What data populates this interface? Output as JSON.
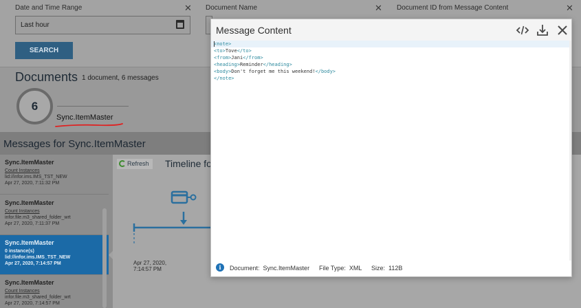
{
  "filters": {
    "date_range": {
      "label": "Date and Time Range",
      "value": "Last hour"
    },
    "document_name": {
      "label": "Document Name",
      "value": ""
    },
    "document_id": {
      "label": "Document ID from Message Content",
      "value": ""
    },
    "close_glyph": "✕",
    "search_label": "SEARCH"
  },
  "documents": {
    "title": "Documents",
    "summary": "1 document, 6 messages",
    "ring_count": "6",
    "doc_name": "Sync.ItemMaster"
  },
  "messages": {
    "title": "Messages for Sync.ItemMaster",
    "items": [
      {
        "name": "Sync.ItemMaster",
        "line1": "Count Instances",
        "line2": "lid://infor.ims.IMS_TST_NEW",
        "time": "Apr 27, 2020, 7:11:32 PM",
        "selected": false
      },
      {
        "name": "Sync.ItemMaster",
        "line1": "Count Instances",
        "line2": "infor.file.m3_shared_folder_wrt",
        "time": "Apr 27, 2020, 7:11:37 PM",
        "selected": false
      },
      {
        "name": "Sync.ItemMaster",
        "line1": "0 instance(s)",
        "line2": "lid://infor.ims.IMS_TST_NEW",
        "time": "Apr 27, 2020, 7:14:57 PM",
        "selected": true
      },
      {
        "name": "Sync.ItemMaster",
        "line1": "Count Instances",
        "line2": "infor.file.m3_shared_folder_wrt",
        "time": "Apr 27, 2020, 7:14:57 PM",
        "selected": false
      }
    ]
  },
  "timeline": {
    "refresh_label": "Refresh",
    "title": "Timeline fo",
    "date_line1": "Apr 27, 2020,",
    "date_line2": "7:14:57 PM"
  },
  "modal": {
    "title": "Message Content",
    "icons": [
      "code-icon",
      "download-icon",
      "close-icon"
    ],
    "code_lines": [
      {
        "open": "<note>",
        "text": "",
        "close": ""
      },
      {
        "open": "<to>",
        "text": "Tove",
        "close": "</to>"
      },
      {
        "open": "<from>",
        "text": "Jani",
        "close": "</from>"
      },
      {
        "open": "<heading>",
        "text": "Reminder",
        "close": "</heading>"
      },
      {
        "open": "<body>",
        "text": "Don't forget me this weekend!",
        "close": "</body>"
      },
      {
        "open": "</note>",
        "text": "",
        "close": ""
      }
    ],
    "footer": {
      "info_glyph": "i",
      "document_label": "Document:",
      "document_value": "Sync.ItemMaster",
      "filetype_label": "File Type:",
      "filetype_value": "XML",
      "size_label": "Size:",
      "size_value": "112B"
    }
  },
  "colors": {
    "accent": "#1f72b6",
    "selected_row": "#1b6aa7",
    "xml_tag": "#2d8a9e",
    "annotation_red": "#e02020"
  }
}
